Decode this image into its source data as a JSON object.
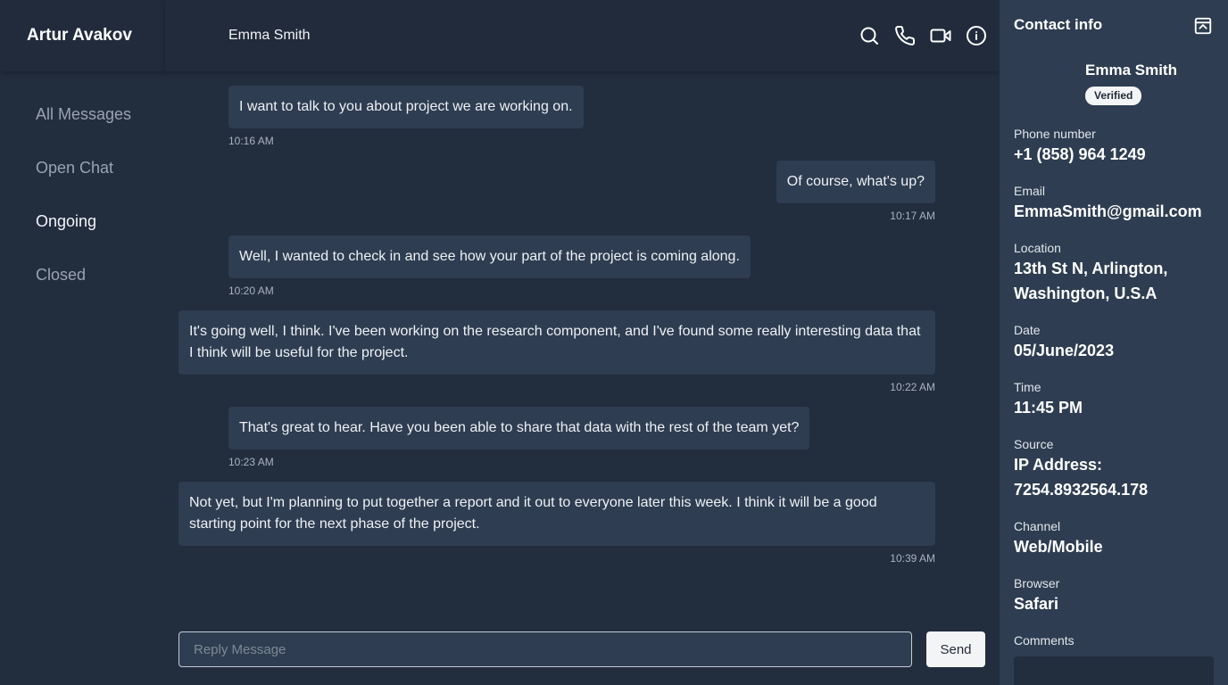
{
  "sidebar": {
    "user_name": "Artur Avakov",
    "items": [
      {
        "label": "All Messages"
      },
      {
        "label": "Open Chat"
      },
      {
        "label": "Ongoing"
      },
      {
        "label": "Closed"
      }
    ]
  },
  "chat": {
    "contact_name": "Emma Smith",
    "header_icons": [
      "search-icon",
      "phone-icon",
      "video-icon",
      "info-icon"
    ],
    "messages": [
      {
        "side": "left",
        "text": "I want to talk to you about project we are working on.",
        "time": "10:16 AM"
      },
      {
        "side": "right",
        "text": "Of course, what's up?",
        "time": "10:17 AM"
      },
      {
        "side": "left",
        "text": "Well, I wanted to check in and see how your part of the project is coming along.",
        "time": "10:20 AM"
      },
      {
        "side": "right",
        "text": "It's going well, I think. I've been working on the research component, and I've found some really interesting data that I think will be useful for the project.",
        "time": "10:22 AM"
      },
      {
        "side": "left",
        "text": "That's great to hear. Have you been able to share that data with the rest of the team yet?",
        "time": "10:23 AM"
      },
      {
        "side": "right",
        "text": "Not yet, but I'm planning to put together a report and it out to everyone later this week. I think it will be a good starting point for the next phase of the project.",
        "time": "10:39 AM"
      }
    ],
    "reply_placeholder": "Reply Message",
    "send_label": "Send"
  },
  "contact": {
    "title": "Contact info",
    "name": "Emma Smith",
    "badge": "Verified",
    "fields": [
      {
        "label": "Phone number",
        "value": "+1 (858) 964 1249"
      },
      {
        "label": "Email",
        "value": "EmmaSmith@gmail.com"
      },
      {
        "label": "Location",
        "value": "13th St N, Arlington, Washington, U.S.A"
      },
      {
        "label": "Date",
        "value": "05/June/2023"
      },
      {
        "label": "Time",
        "value": "11:45 PM"
      },
      {
        "label": "Source",
        "value": "IP Address: 7254.8932564.178"
      },
      {
        "label": "Channel",
        "value": "Web/Mobile"
      },
      {
        "label": "Browser",
        "value": "Safari"
      },
      {
        "label": "Comments",
        "value": ""
      }
    ]
  },
  "colors": {
    "background": "#222d3e",
    "bubble": "#2e3d51",
    "panel": "#2e3d51",
    "button": "#f3f4f6"
  }
}
